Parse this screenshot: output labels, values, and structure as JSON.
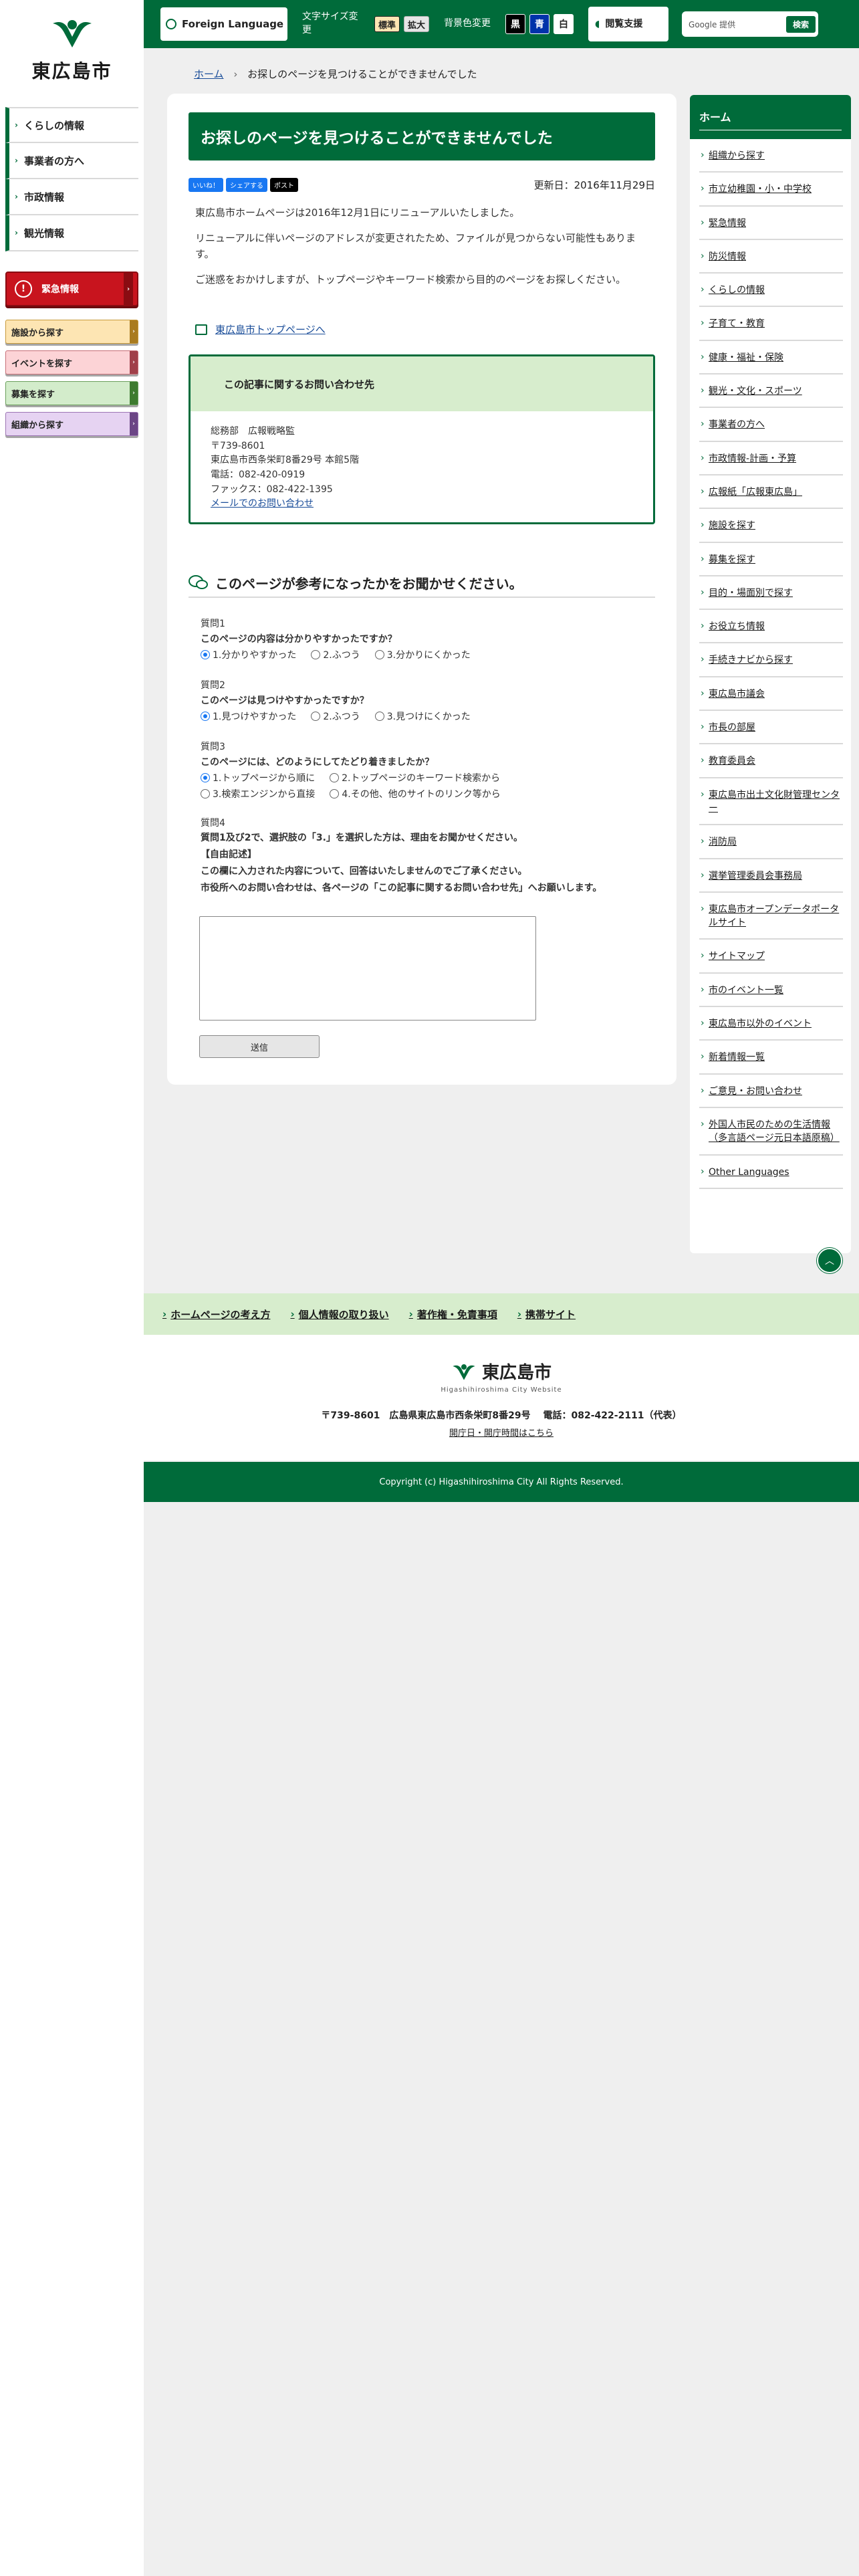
{
  "site": {
    "name": "東広島市",
    "english": "Higashihiroshima City Website"
  },
  "header": {
    "foreign_language": "Foreign Language",
    "font_size_label": "文字サイズ変更",
    "font_size_standard": "標準",
    "font_size_large": "拡大",
    "bg_color_label": "背景色変更",
    "bg_black": "黒",
    "bg_blue": "青",
    "bg_white": "白",
    "assist": "閲覧支援",
    "search_placeholder": "Google 提供",
    "search_button": "検索"
  },
  "left_nav": {
    "items": [
      "くらしの情報",
      "事業者の方へ",
      "市政情報",
      "観光情報"
    ],
    "emergency": "緊急情報",
    "search_buttons": [
      "施設から探す",
      "イベントを探す",
      "募集を探す",
      "組織から探す"
    ]
  },
  "breadcrumb": {
    "home": "ホーム",
    "current": "お探しのページを見つけることができませんでした"
  },
  "main": {
    "title": "お探しのページを見つけることができませんでした",
    "social": {
      "like": "いいね！",
      "share": "シェアする",
      "post": "ポスト"
    },
    "updated": "更新日：2016年11月29日",
    "paragraphs": [
      "東広島市ホームページは2016年12月1日にリニューアルいたしました。",
      "リニューアルに伴いページのアドレスが変更されたため、ファイルが見つからない可能性もあります。",
      "ご迷惑をおかけしますが、トップページやキーワード検索から目的のページをお探しください。"
    ],
    "top_link": "東広島市トップページへ"
  },
  "contact": {
    "heading": "この記事に関するお問い合わせ先",
    "dept": "総務部　広報戦略監",
    "zip": "〒739-8601",
    "address": "東広島市西条栄町8番29号 本館5階",
    "phone": "電話：082-420-0919",
    "fax": "ファックス：082-422-1395",
    "mail_link": "メールでのお問い合わせ"
  },
  "survey": {
    "title": "このページが参考になったかをお聞かせください。",
    "questions": [
      {
        "num": "質問1",
        "text": "このページの内容は分かりやすかったですか？",
        "options": [
          "1.分かりやすかった",
          "2.ふつう",
          "3.分かりにくかった"
        ],
        "selected": 0
      },
      {
        "num": "質問2",
        "text": "このページは見つけやすかったですか？",
        "options": [
          "1.見つけやすかった",
          "2.ふつう",
          "3.見つけにくかった"
        ],
        "selected": 0
      },
      {
        "num": "質問3",
        "text": "このページには、どのようにしてたどり着きましたか？",
        "options": [
          "1.トップページから順に",
          "2.トップページのキーワード検索から",
          "3.検索エンジンから直接",
          "4.その他、他のサイトのリンク等から"
        ],
        "selected": 0
      }
    ],
    "q4_num": "質問4",
    "q4_text": "質問1及び2で、選択肢の「3.」を選択した方は、理由をお聞かせください。",
    "q4_free": "【自由記述】",
    "q4_note1": "この欄に入力された内容について、回答はいたしませんのでご了承ください。",
    "q4_note2": "市役所へのお問い合わせは、各ページの「この記事に関するお問い合わせ先」へお願いします。",
    "submit": "送信"
  },
  "right_nav": {
    "heading": "ホーム",
    "items": [
      "組織から探す",
      "市立幼稚園・小・中学校",
      "緊急情報",
      "防災情報",
      "くらしの情報",
      "子育て・教育",
      "健康・福祉・保険",
      "観光・文化・スポーツ",
      "事業者の方へ",
      "市政情報-計画・予算",
      "広報紙「広報東広島」",
      "施設を探す",
      "募集を探す",
      "目的・場面別で探す",
      "お役立ち情報",
      "手続きナビから探す",
      "東広島市議会",
      "市長の部屋",
      "教育委員会",
      "東広島市出土文化財管理センター",
      "消防局",
      "選挙管理委員会事務局",
      "東広島市オープンデータポータルサイト",
      "サイトマップ",
      "市のイベント一覧",
      "東広島市以外のイベント",
      "新着情報一覧",
      "ご意見・お問い合わせ",
      "外国人市民のための生活情報（多言語ページ元日本語原稿）",
      "Other Languages"
    ]
  },
  "footer": {
    "links": [
      "ホームページの考え方",
      "個人情報の取り扱い",
      "著作権・免責事項",
      "携帯サイト"
    ],
    "address": "〒739-8601　広島県東広島市西条栄町8番29号　 電話：082-422-2111（代表）",
    "hours": "開庁日・開庁時間はこちら",
    "copyright": "Copyright (c) Higashihiroshima City All Rights Reserved."
  },
  "colors": {
    "brand": "#006b3a",
    "emergency": "#c8141e",
    "link": "#1a4d99"
  }
}
